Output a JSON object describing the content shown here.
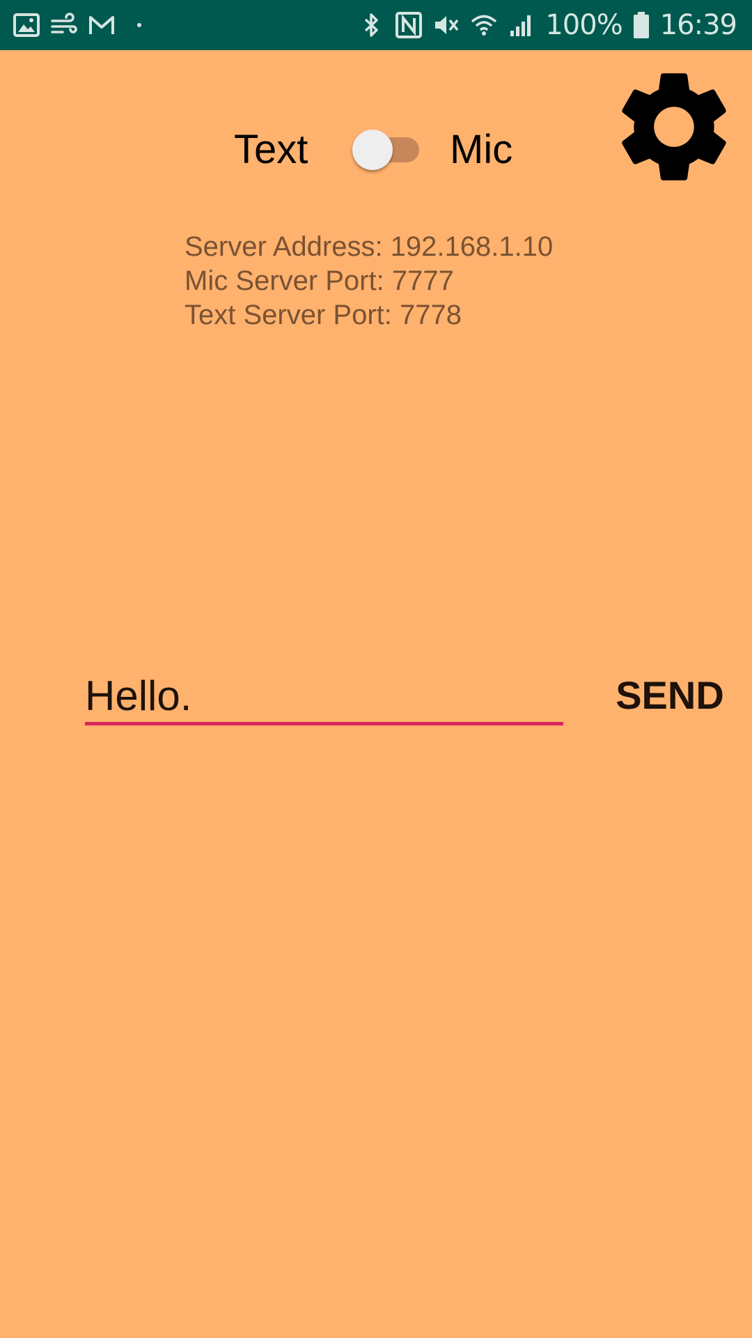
{
  "status_bar": {
    "left_icons": [
      "gallery-icon",
      "wind-icon",
      "gmail-icon",
      "dot-icon"
    ],
    "right_icons": [
      "bluetooth-icon",
      "nfc-icon",
      "mute-icon",
      "wifi-icon",
      "signal-icon"
    ],
    "battery_text": "100%",
    "battery_icon": "battery-icon",
    "time": "16:39",
    "background_color": "#00594F"
  },
  "mode_toggle": {
    "left_label": "Text",
    "right_label": "Mic",
    "state": "Text"
  },
  "settings": {
    "icon": "gear-icon"
  },
  "server_info": {
    "address_line": "Server Address: 192.168.1.10",
    "mic_port_line": "Mic Server Port: 7777",
    "text_port_line": "Text Server Port: 7778"
  },
  "message": {
    "input_value": "Hello.",
    "send_label": "SEND",
    "underline_color": "#D8265B"
  },
  "theme": {
    "background": "#FFB26E",
    "accent": "#D8265B"
  }
}
